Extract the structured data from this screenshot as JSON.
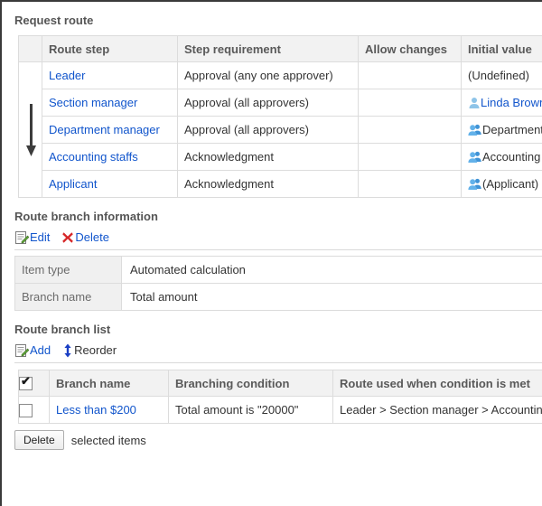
{
  "request_route": {
    "title": "Request route",
    "flow_icon": "down-arrow-icon",
    "columns": [
      "Route step",
      "Step requirement",
      "Allow changes",
      "Initial value"
    ],
    "rows": [
      {
        "step": "Leader",
        "requirement": "Approval (any one approver)",
        "allow_changes": "",
        "initial_value": "(Undefined)",
        "initial_value_icon": "none"
      },
      {
        "step": "Section manager",
        "requirement": "Approval (all approvers)",
        "allow_changes": "",
        "initial_value": "Linda Brown",
        "initial_value_icon": "user-icon"
      },
      {
        "step": "Department manager",
        "requirement": "Approval (all approvers)",
        "allow_changes": "",
        "initial_value": "Department managers",
        "initial_value_icon": "group-icon"
      },
      {
        "step": "Accounting staffs",
        "requirement": "Acknowledgment",
        "allow_changes": "",
        "initial_value": "Accounting staffs",
        "initial_value_icon": "group-icon"
      },
      {
        "step": "Applicant",
        "requirement": "Acknowledgment",
        "allow_changes": "",
        "initial_value": "(Applicant)",
        "initial_value_icon": "group-icon"
      }
    ]
  },
  "branch_information": {
    "title": "Route branch information",
    "actions": {
      "edit": {
        "label": "Edit",
        "icon": "edit-document-icon"
      },
      "delete": {
        "label": "Delete",
        "icon": "red-x-icon"
      }
    },
    "fields": [
      {
        "label": "Item type",
        "value": "Automated calculation"
      },
      {
        "label": "Branch name",
        "value": "Total amount"
      }
    ]
  },
  "branch_list": {
    "title": "Route branch list",
    "actions": {
      "add": {
        "label": "Add",
        "icon": "add-document-icon"
      },
      "reorder": {
        "label": "Reorder",
        "icon": "up-down-arrow-icon"
      }
    },
    "columns": [
      "Branch name",
      "Branching condition",
      "Route used when condition is met"
    ],
    "select_all_checked": true,
    "rows": [
      {
        "checked": false,
        "name": "Less than $200",
        "condition": "Total amount is \"20000\"",
        "route": "Leader > Section manager > Accounting staffs > Applicant"
      }
    ],
    "footer": {
      "delete_button": "Delete",
      "note": "selected items"
    }
  },
  "colors": {
    "link": "#1155cc",
    "heading": "#555555",
    "header_bg": "#f2f2f2",
    "label_bg": "#f0f0f0",
    "border": "#dcdcdc",
    "delete_icon": "#d62728",
    "reorder_icon": "#1a3fc4"
  }
}
